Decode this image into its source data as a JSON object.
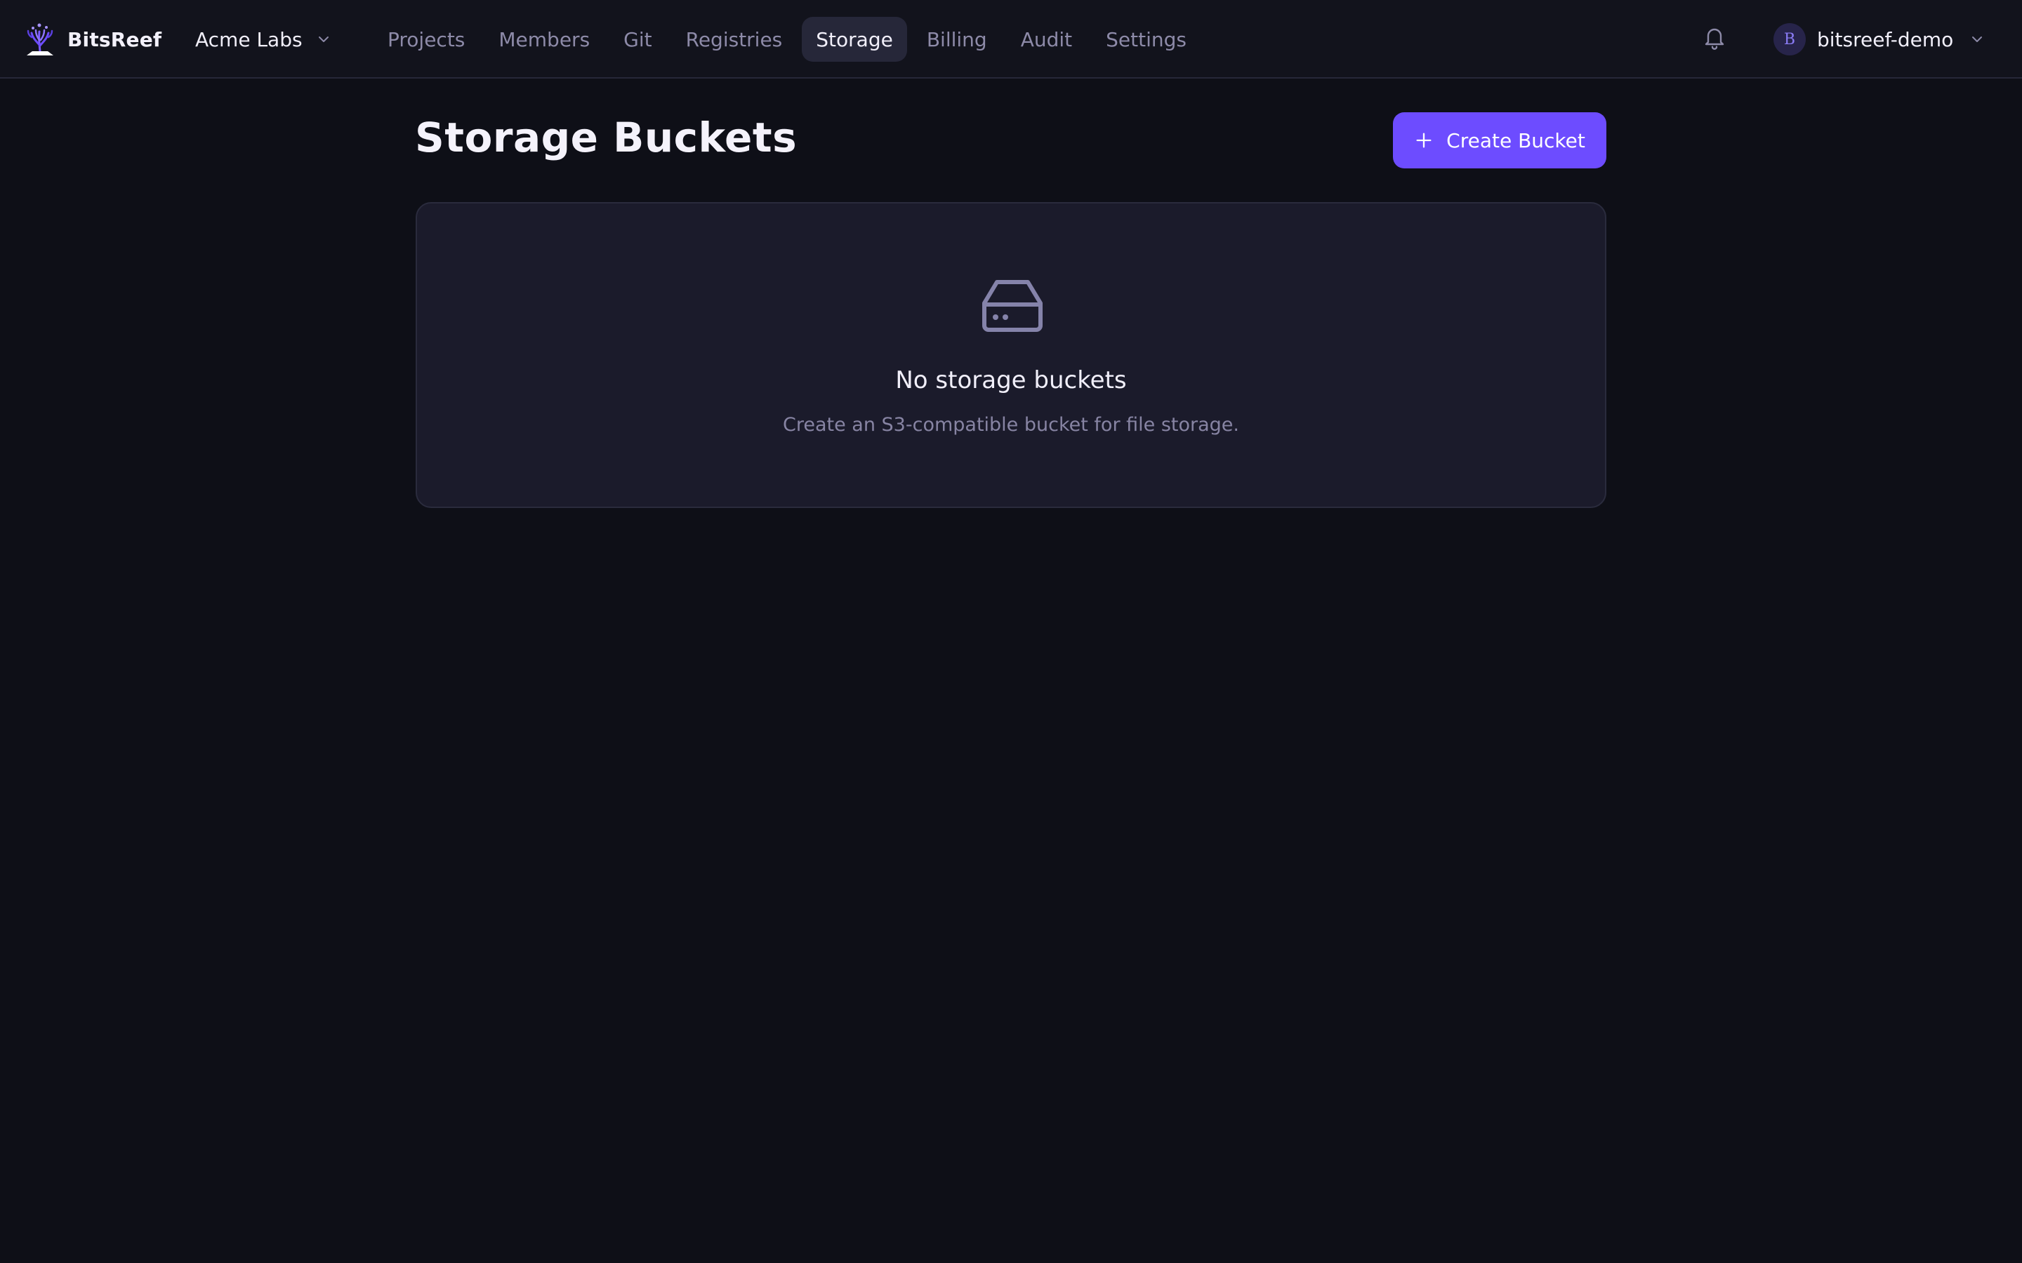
{
  "brand": {
    "name": "BitsReef",
    "logo_icon": "coral-reef-logo-icon"
  },
  "org_switcher": {
    "name": "Acme Labs",
    "icon": "chevron-down-icon"
  },
  "nav": {
    "items": [
      {
        "label": "Projects",
        "active": false
      },
      {
        "label": "Members",
        "active": false
      },
      {
        "label": "Git",
        "active": false
      },
      {
        "label": "Registries",
        "active": false
      },
      {
        "label": "Storage",
        "active": true
      },
      {
        "label": "Billing",
        "active": false
      },
      {
        "label": "Audit",
        "active": false
      },
      {
        "label": "Settings",
        "active": false
      }
    ]
  },
  "header_actions": {
    "notifications_icon": "bell-icon"
  },
  "user_menu": {
    "avatar_initial": "B",
    "username": "bitsreef-demo",
    "icon": "chevron-down-icon"
  },
  "page": {
    "title": "Storage Buckets",
    "create_button": {
      "label": "Create Bucket",
      "icon": "plus-icon"
    }
  },
  "empty_state": {
    "icon": "hard-drive-icon",
    "title": "No storage buckets",
    "description": "Create an S3-compatible bucket for file storage."
  },
  "colors": {
    "background": "#0e0f17",
    "topbar": "#12131c",
    "accent": "#6d4cff",
    "card": "#1b1b2b",
    "muted_text": "#8d8aa8",
    "active_tab": "#262739"
  }
}
